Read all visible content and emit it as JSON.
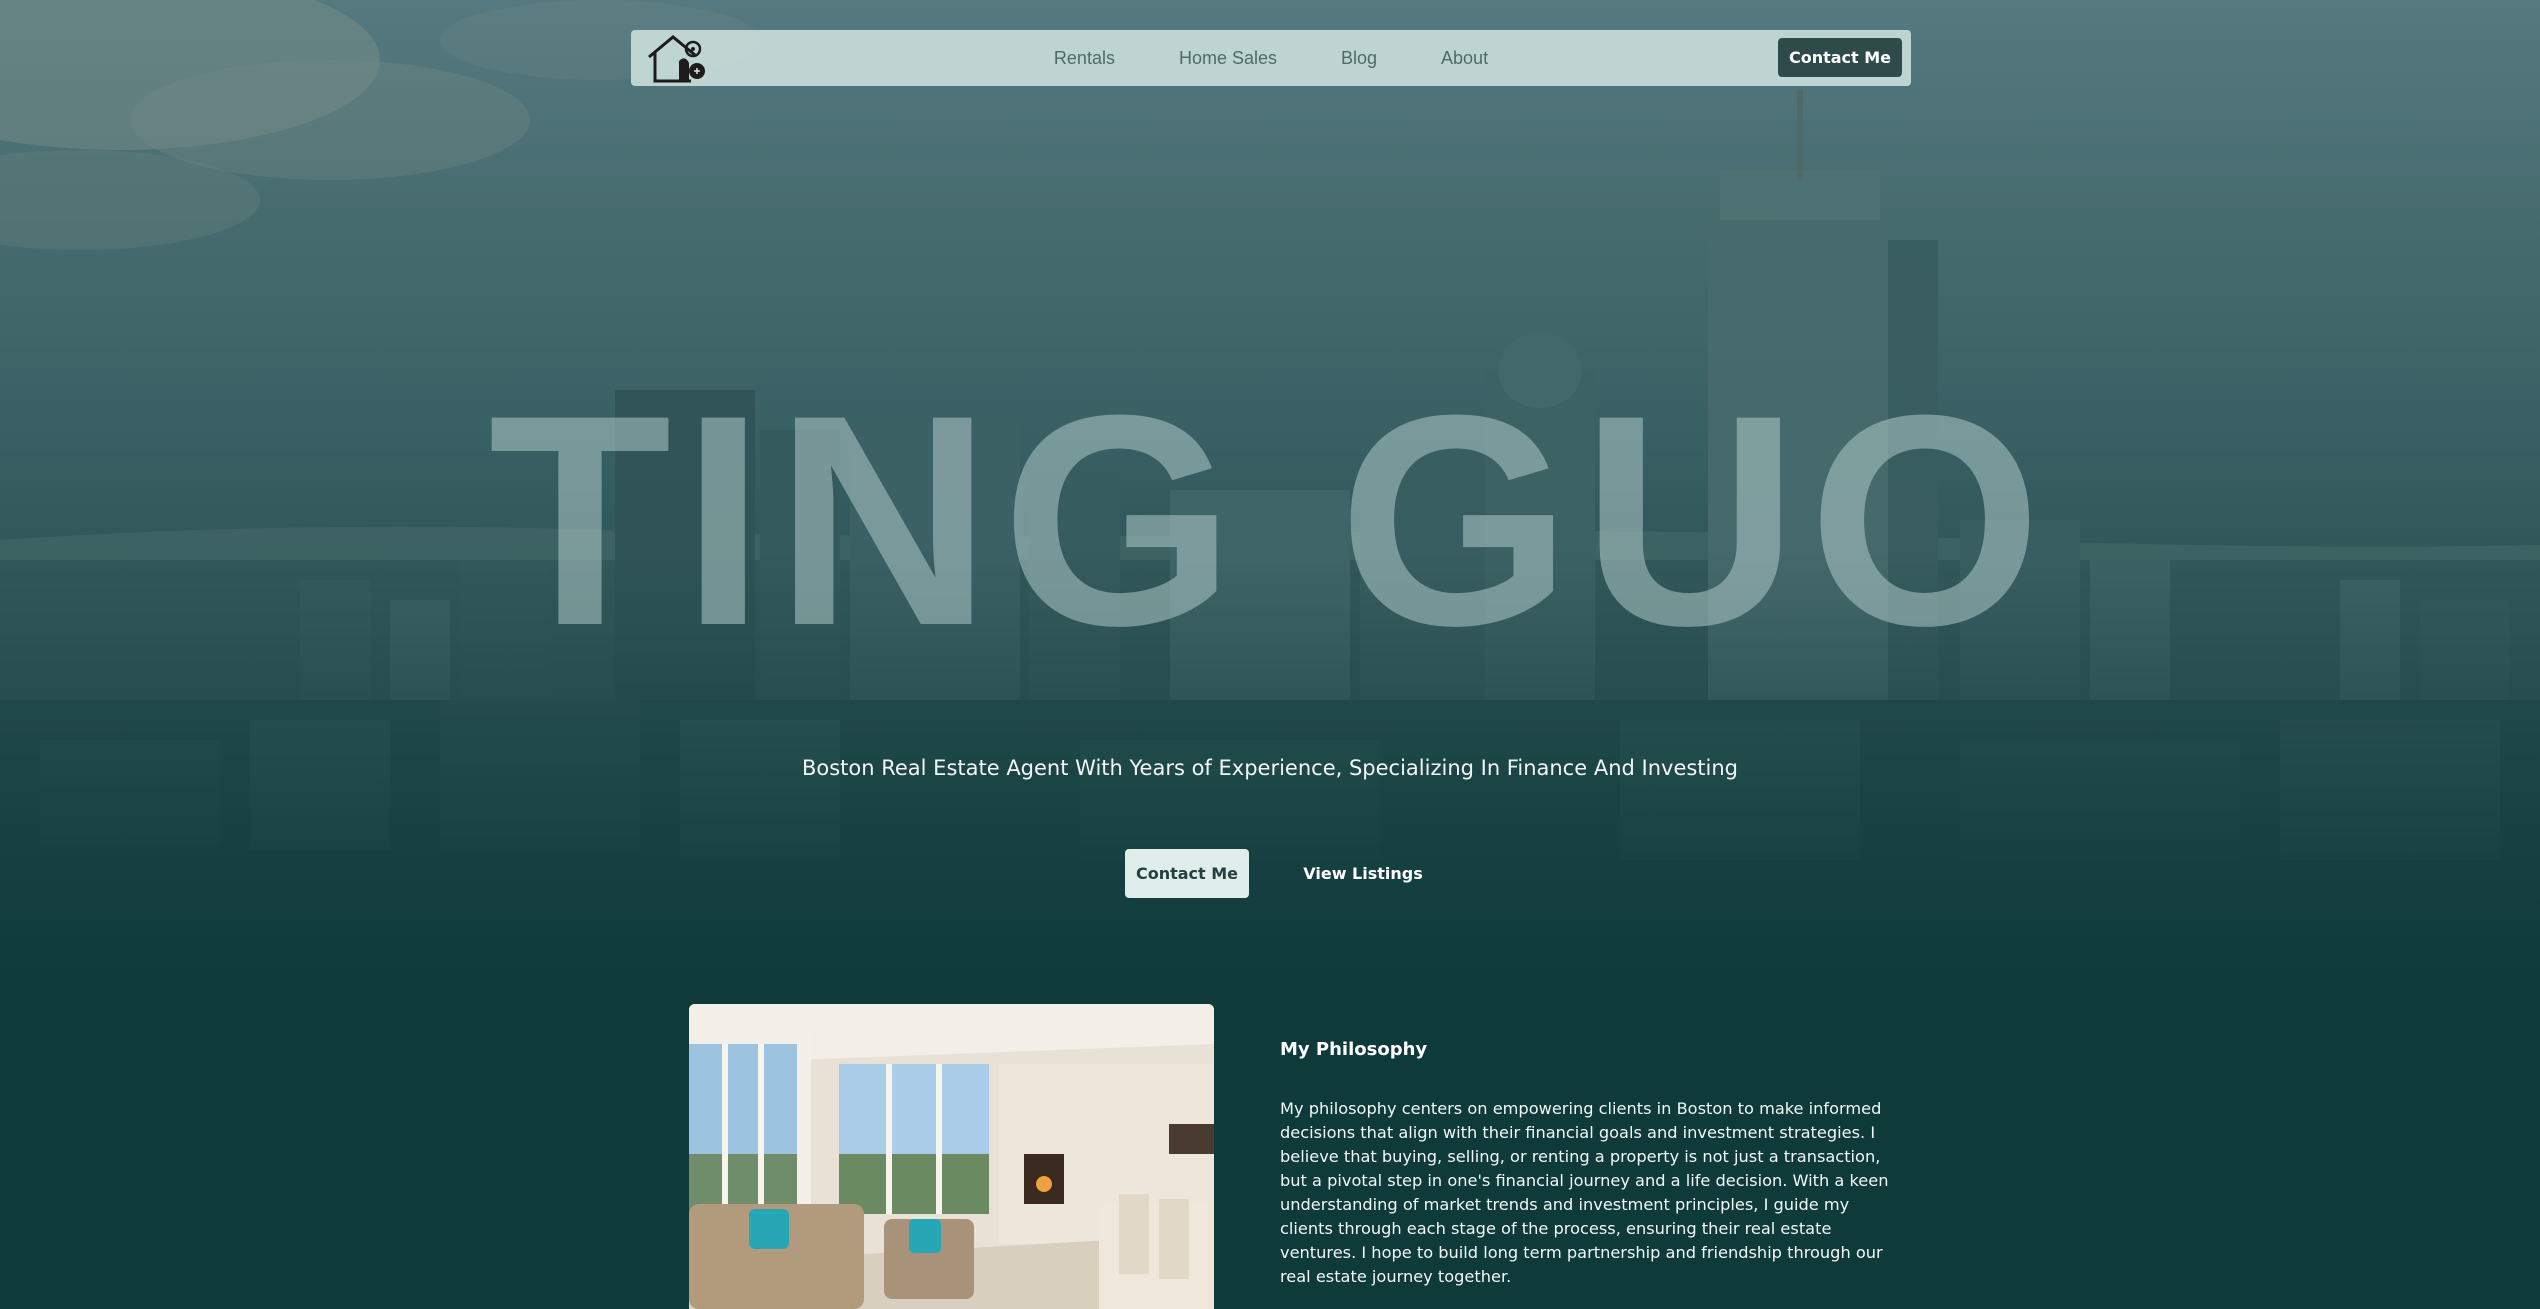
{
  "nav": {
    "logo_icon": "house-key-logo-icon",
    "links": [
      "Rentals",
      "Home Sales",
      "Blog",
      "About"
    ],
    "cta_label": "Contact Me"
  },
  "hero": {
    "name": "TING GUO",
    "tagline": "Boston Real Estate Agent With Years of Experience, Specializing In Finance And Investing",
    "primary_button": "Contact Me",
    "secondary_button": "View Listings",
    "background_image": "boston-skyline-image"
  },
  "philosophy": {
    "image": "living-room-photo",
    "title": "My Philosophy",
    "body": "My philosophy centers on empowering clients in Boston to make informed decisions that align with their financial goals and investment strategies. I believe that buying, selling, or renting a property is not just a transaction, but a pivotal step in one's financial journey and a life decision. With a keen understanding of market trends and investment principles, I guide my clients through each stage of the process, ensuring their real estate ventures. I hope to build long term partnership and friendship through our real estate journey together."
  },
  "colors": {
    "background": "#0e3a3a",
    "nav_cta": "#2e4b4a",
    "primary_button": "#dfeeea"
  }
}
